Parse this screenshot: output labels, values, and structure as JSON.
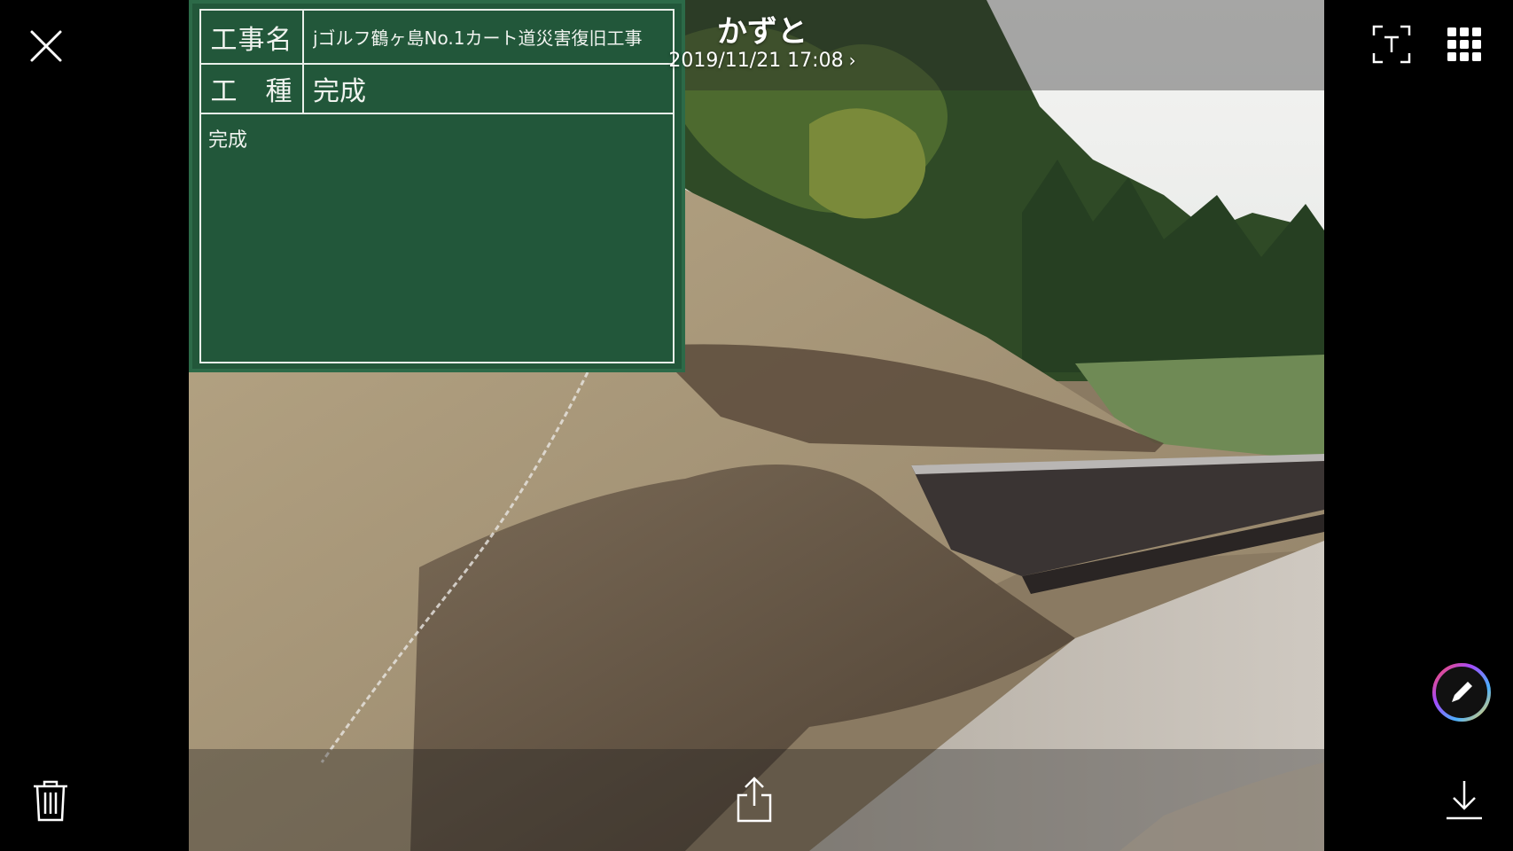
{
  "app": {
    "title": "かずと",
    "datetime": "2019/11/21 17:08",
    "colors": {
      "background": "#000000",
      "board": "#22573a",
      "chalk": "#f0f3ef"
    }
  },
  "toolbar": {
    "close_icon": "close-icon",
    "text_scan_icon": "text-recognition-icon",
    "grid_icon": "grid-icon",
    "edit_icon": "pencil-icon",
    "delete_icon": "trash-icon",
    "share_icon": "share-icon",
    "download_icon": "download-icon"
  },
  "blackboard": {
    "row1_label": "工事名",
    "row1_value": "jゴルフ鶴ヶ島No.1カート道災害復旧工事",
    "row2_label": "工　種",
    "row2_value": "完成",
    "note": "完成"
  }
}
